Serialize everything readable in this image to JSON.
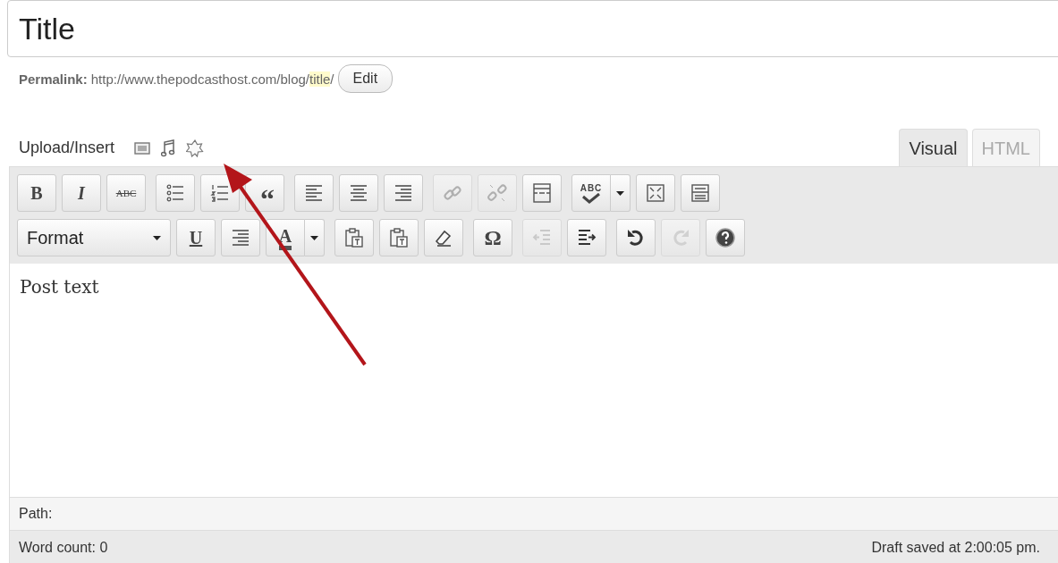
{
  "title_field": {
    "value": "Title"
  },
  "permalink": {
    "label": "Permalink:",
    "url": "http://www.thepodcasthost.com/blog/",
    "slug": "title",
    "suffix": "/",
    "button": "Edit"
  },
  "upload_insert": {
    "label": "Upload/Insert"
  },
  "tabs": [
    {
      "label": "Visual",
      "selected": true
    },
    {
      "label": "HTML",
      "selected": false
    }
  ],
  "toolbar": [
    [
      [
        {
          "kind": "bold",
          "label": "B",
          "disabled": false
        },
        {
          "kind": "italic",
          "label": "I",
          "disabled": false
        },
        {
          "kind": "strike",
          "label": "ABC",
          "disabled": false
        }
      ],
      [
        {
          "kind": "bullets",
          "disabled": false
        },
        {
          "kind": "numbering",
          "disabled": false
        },
        {
          "kind": "quote",
          "label": "“",
          "disabled": false
        }
      ],
      [
        {
          "kind": "alignleft",
          "disabled": false
        },
        {
          "kind": "aligncenter",
          "disabled": false
        },
        {
          "kind": "alignright",
          "disabled": false
        }
      ],
      [
        {
          "kind": "link",
          "disabled": true
        },
        {
          "kind": "unlink",
          "disabled": true
        },
        {
          "kind": "more",
          "disabled": false
        }
      ],
      [
        {
          "kind": "spellcheck",
          "label": "ABC",
          "disabled": false
        },
        {
          "kind": "fullscreen",
          "disabled": false
        },
        {
          "kind": "sink",
          "disabled": false
        }
      ]
    ],
    [
      [
        {
          "kind": "format",
          "label": "Format",
          "disabled": false
        },
        {
          "kind": "underline",
          "label": "U",
          "disabled": false
        },
        {
          "kind": "justify",
          "disabled": false
        },
        {
          "kind": "color",
          "label": "A",
          "disabled": false
        }
      ],
      [
        {
          "kind": "pastetext",
          "disabled": false
        },
        {
          "kind": "pasteword",
          "disabled": false
        },
        {
          "kind": "eraser",
          "disabled": false
        }
      ],
      [
        {
          "kind": "omega",
          "label": "Ω",
          "disabled": false
        }
      ],
      [
        {
          "kind": "outdent",
          "disabled": true
        },
        {
          "kind": "indent",
          "disabled": false
        }
      ],
      [
        {
          "kind": "undo",
          "disabled": false
        },
        {
          "kind": "redo",
          "disabled": true
        },
        {
          "kind": "help",
          "disabled": false
        }
      ]
    ]
  ],
  "content": {
    "text": "Post text"
  },
  "path_bar": {
    "label": "Path:"
  },
  "status_bar": {
    "word_count": "Word count: 0",
    "draft_saved": "Draft saved at 2:00:05 pm."
  }
}
